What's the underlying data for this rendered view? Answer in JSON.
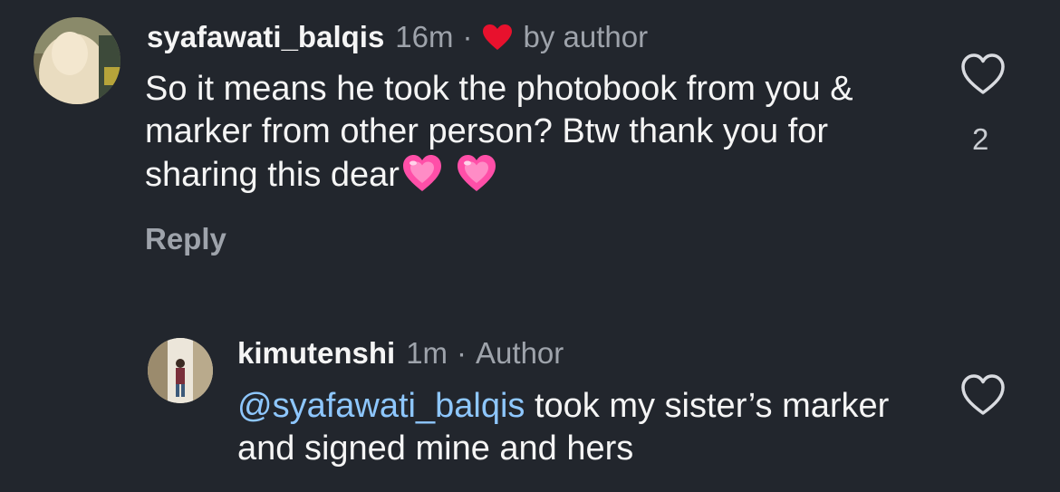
{
  "comments": [
    {
      "username": "syafawati_balqis",
      "time": "16m",
      "separator": "·",
      "badge": "by author",
      "badge_icon": "red-heart-icon",
      "text": "So it means he took the photobook from you & marker from other person? Btw thank you for sharing this dear",
      "emojis": [
        "growing-heart-emoji",
        "growing-heart-emoji"
      ],
      "reply_label": "Reply",
      "like_count": "2"
    },
    {
      "username": "kimutenshi",
      "time": "1m",
      "separator": "·",
      "badge": "Author",
      "mention": "@syafawati_balqis",
      "text": " took my sister’s marker and signed mine and hers"
    }
  ],
  "colors": {
    "background": "#22262d",
    "mention": "#8ec7ff",
    "muted": "#9ea3ab",
    "heart": "#e8112d",
    "emoji_heart": "#ff4fa8"
  }
}
